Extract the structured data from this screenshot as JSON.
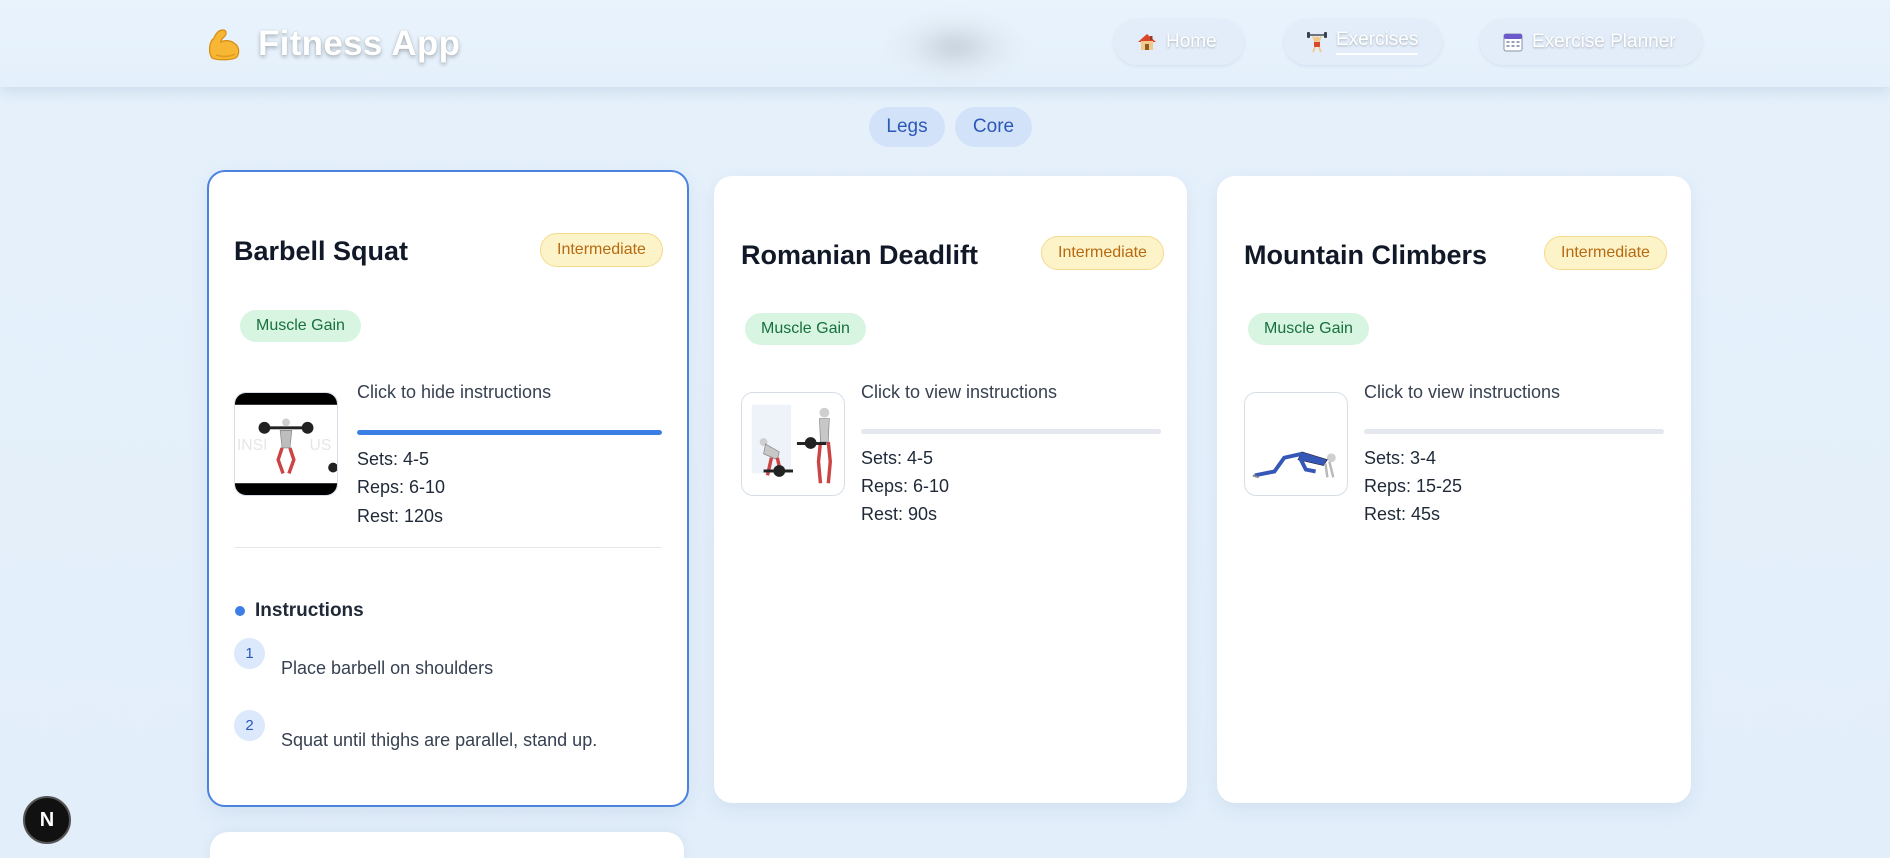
{
  "header": {
    "brand_title": "Fitness App",
    "brand_icon": "flexed-biceps-icon",
    "nav": [
      {
        "label": "Home",
        "icon": "house-icon"
      },
      {
        "label": "Exercises",
        "icon": "weightlifter-icon"
      },
      {
        "label": "Exercise Planner",
        "icon": "calendar-icon"
      }
    ]
  },
  "filters": [
    "Legs",
    "Core"
  ],
  "cards": [
    {
      "title": "Barbell Squat",
      "level": "Intermediate",
      "goal": "Muscle Gain",
      "toggle": "Click to hide instructions",
      "progress": 1.0,
      "sets": "Sets: 4-5",
      "reps": "Reps: 6-10",
      "rest": "Rest: 120s",
      "expanded": true,
      "instructions_heading": "Instructions",
      "steps": [
        {
          "num": "1",
          "text": "Place barbell on shoulders"
        },
        {
          "num": "2",
          "text": "Squat until thighs are parallel, stand up."
        }
      ]
    },
    {
      "title": "Romanian Deadlift",
      "level": "Intermediate",
      "goal": "Muscle Gain",
      "toggle": "Click to view instructions",
      "progress": 0.0,
      "sets": "Sets: 4-5",
      "reps": "Reps: 6-10",
      "rest": "Rest: 90s"
    },
    {
      "title": "Mountain Climbers",
      "level": "Intermediate",
      "goal": "Muscle Gain",
      "toggle": "Click to view instructions",
      "progress": 0.0,
      "sets": "Sets: 3-4",
      "reps": "Reps: 15-25",
      "rest": "Rest: 45s"
    }
  ],
  "dev_badge": "N",
  "colors": {
    "accent": "#3b7fe6",
    "level_badge": "#fdf3c8",
    "goal_badge": "#d8f5e2"
  }
}
